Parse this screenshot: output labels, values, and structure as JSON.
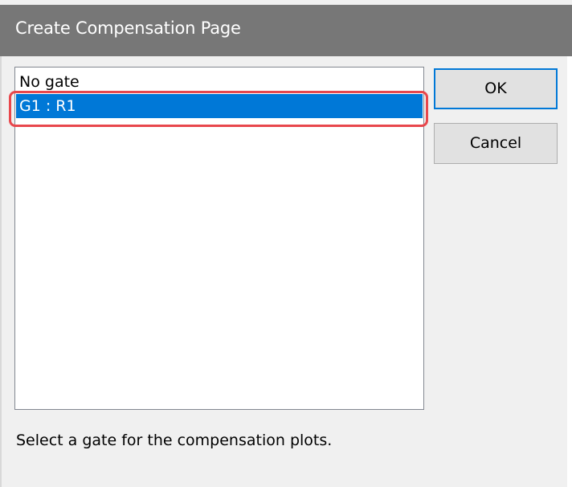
{
  "window": {
    "title": "Create Compensation Page"
  },
  "gate_list": {
    "items": [
      {
        "label": "No gate",
        "selected": false
      },
      {
        "label": "G1 : R1",
        "selected": true
      }
    ]
  },
  "buttons": {
    "ok_label": "OK",
    "cancel_label": "Cancel"
  },
  "hint_text": "Select a gate for the compensation plots.",
  "colors": {
    "selection": "#0078d7",
    "highlight_outline": "#e8474c",
    "titlebar": "#777777"
  }
}
